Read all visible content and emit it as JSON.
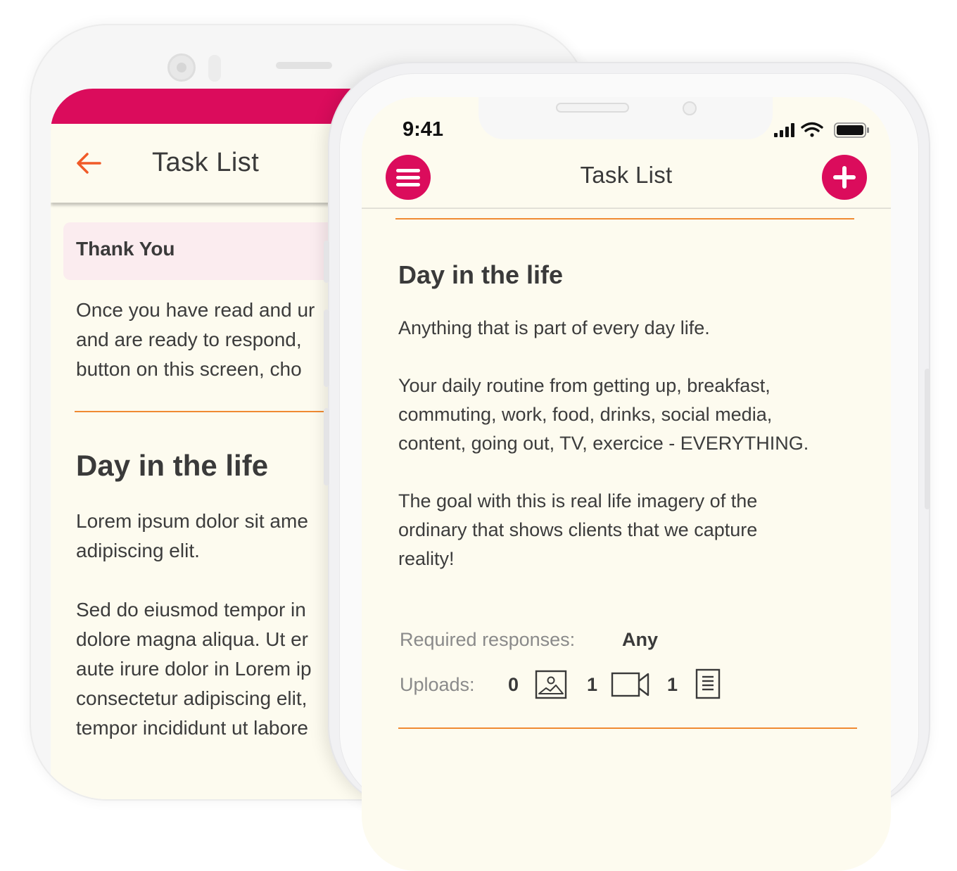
{
  "back_phone": {
    "header_title": "Task List",
    "card_title": "Thank You",
    "intro_lines": [
      "Once you have read and ur",
      "and are ready to respond,"
    ],
    "intro_bold_line": "button on this screen, cho",
    "section_title": "Day in the life",
    "lorem_lines": [
      "Lorem ipsum dolor sit ame",
      "adipiscing elit."
    ],
    "body_lines": [
      "Sed do eiusmod tempor in",
      "dolore magna aliqua. Ut er",
      "aute irure dolor in Lorem ip",
      "consectetur adipiscing elit,",
      "tempor incididunt ut labore"
    ]
  },
  "front_phone": {
    "status_time": "9:41",
    "header_title": "Task List",
    "section_title": "Day in the life",
    "description": "Anything that is part of every day life.",
    "routine_lines": [
      "Your daily routine from getting up, breakfast,",
      "commuting, work, food, drinks, social media,",
      "content, going out, TV, exercice - EVERYTHING."
    ],
    "goal_lines": [
      "The goal with this is real life imagery of the",
      "ordinary that shows clients that we capture",
      "reality!"
    ],
    "required_label": "Required responses:",
    "required_value": "Any",
    "uploads_label": "Uploads:",
    "uploads": [
      {
        "count": "0",
        "icon": "image-icon"
      },
      {
        "count": "1",
        "icon": "video-icon"
      },
      {
        "count": "1",
        "icon": "document-icon"
      }
    ]
  },
  "colors": {
    "accent": "#db0c5c",
    "rule": "#f08a32",
    "screen_bg": "#fdfbef",
    "card_bg": "#fbecef"
  }
}
